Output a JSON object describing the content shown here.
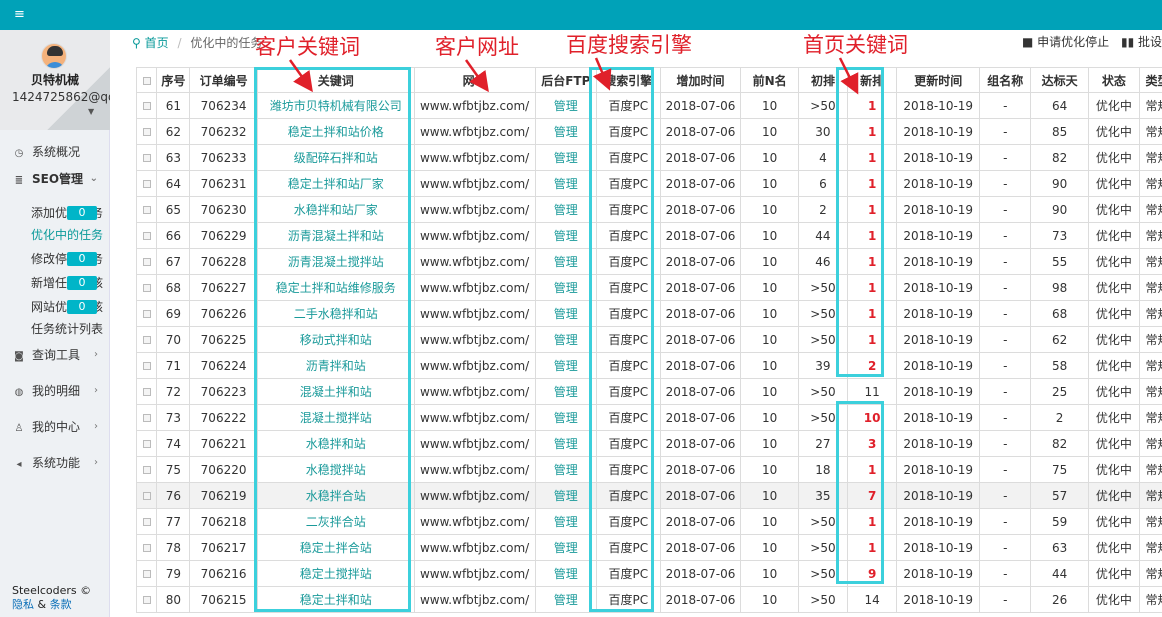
{
  "topbar": {
    "menu_icon": "≡"
  },
  "sidebar": {
    "user_name": "贝特机械",
    "user_id": "1424725862@qq.",
    "nav": [
      {
        "icon": "◷",
        "label": "系统概况"
      },
      {
        "icon": "≣",
        "label": "SEO管理",
        "arrow": "⌄"
      },
      {
        "icon": "◙",
        "label": "查询工具",
        "arrow": "›"
      },
      {
        "icon": "◍",
        "label": "我的明细",
        "arrow": "›"
      },
      {
        "icon": "♙",
        "label": "我的中心",
        "arrow": "›"
      },
      {
        "icon": "◂",
        "label": "系统功能",
        "arrow": "›"
      }
    ],
    "sub": [
      {
        "label": "添加优化任务",
        "badge": "0"
      },
      {
        "label": "优化中的任务"
      },
      {
        "label": "修改停止任务",
        "badge": "0"
      },
      {
        "label": "新增任务审核",
        "badge": "0"
      },
      {
        "label": "网站优化审核",
        "badge": "0"
      },
      {
        "label": "任务统计列表"
      }
    ],
    "footer": {
      "text": "Steelcoders ©",
      "privacy": "隐私",
      "amp": "&",
      "terms": "条款"
    }
  },
  "breadcrumb": {
    "home": "首页",
    "sep": "/",
    "current": "优化中的任务"
  },
  "actions": {
    "stop": "■ 申请优化停止",
    "batch": "▮▮ 批设"
  },
  "table": {
    "headers": [
      "",
      "序号",
      "订单编号",
      "关键词",
      "网址",
      "后台FTP",
      "搜索引擎",
      "增加时间",
      "前N名",
      "初排",
      "新排",
      "更新时间",
      "组名称",
      "达标天",
      "状态",
      "类型"
    ],
    "rows": [
      [
        "61",
        "706234",
        "潍坊市贝特机械有限公司",
        "www.wfbtjbz.com/",
        "管理",
        "百度PC",
        "2018-07-06",
        "10",
        ">50",
        "1",
        "2018-10-19",
        "-",
        "64",
        "优化中",
        "常规"
      ],
      [
        "62",
        "706232",
        "稳定土拌和站价格",
        "www.wfbtjbz.com/",
        "管理",
        "百度PC",
        "2018-07-06",
        "10",
        "30",
        "1",
        "2018-10-19",
        "-",
        "85",
        "优化中",
        "常规"
      ],
      [
        "63",
        "706233",
        "级配碎石拌和站",
        "www.wfbtjbz.com/",
        "管理",
        "百度PC",
        "2018-07-06",
        "10",
        "4",
        "1",
        "2018-10-19",
        "-",
        "82",
        "优化中",
        "常规"
      ],
      [
        "64",
        "706231",
        "稳定土拌和站厂家",
        "www.wfbtjbz.com/",
        "管理",
        "百度PC",
        "2018-07-06",
        "10",
        "6",
        "1",
        "2018-10-19",
        "-",
        "90",
        "优化中",
        "常规"
      ],
      [
        "65",
        "706230",
        "水稳拌和站厂家",
        "www.wfbtjbz.com/",
        "管理",
        "百度PC",
        "2018-07-06",
        "10",
        "2",
        "1",
        "2018-10-19",
        "-",
        "90",
        "优化中",
        "常规"
      ],
      [
        "66",
        "706229",
        "沥青混凝土拌和站",
        "www.wfbtjbz.com/",
        "管理",
        "百度PC",
        "2018-07-06",
        "10",
        "44",
        "1",
        "2018-10-19",
        "-",
        "73",
        "优化中",
        "常规"
      ],
      [
        "67",
        "706228",
        "沥青混凝土搅拌站",
        "www.wfbtjbz.com/",
        "管理",
        "百度PC",
        "2018-07-06",
        "10",
        "46",
        "1",
        "2018-10-19",
        "-",
        "55",
        "优化中",
        "常规"
      ],
      [
        "68",
        "706227",
        "稳定土拌和站维修服务",
        "www.wfbtjbz.com/",
        "管理",
        "百度PC",
        "2018-07-06",
        "10",
        ">50",
        "1",
        "2018-10-19",
        "-",
        "98",
        "优化中",
        "常规"
      ],
      [
        "69",
        "706226",
        "二手水稳拌和站",
        "www.wfbtjbz.com/",
        "管理",
        "百度PC",
        "2018-07-06",
        "10",
        ">50",
        "1",
        "2018-10-19",
        "-",
        "68",
        "优化中",
        "常规"
      ],
      [
        "70",
        "706225",
        "移动式拌和站",
        "www.wfbtjbz.com/",
        "管理",
        "百度PC",
        "2018-07-06",
        "10",
        ">50",
        "1",
        "2018-10-19",
        "-",
        "62",
        "优化中",
        "常规"
      ],
      [
        "71",
        "706224",
        "沥青拌和站",
        "www.wfbtjbz.com/",
        "管理",
        "百度PC",
        "2018-07-06",
        "10",
        "39",
        "2",
        "2018-10-19",
        "-",
        "58",
        "优化中",
        "常规"
      ],
      [
        "72",
        "706223",
        "混凝土拌和站",
        "www.wfbtjbz.com/",
        "管理",
        "百度PC",
        "2018-07-06",
        "10",
        ">50",
        "11",
        "2018-10-19",
        "-",
        "25",
        "优化中",
        "常规"
      ],
      [
        "73",
        "706222",
        "混凝土搅拌站",
        "www.wfbtjbz.com/",
        "管理",
        "百度PC",
        "2018-07-06",
        "10",
        ">50",
        "10",
        "2018-10-19",
        "-",
        "2",
        "优化中",
        "常规"
      ],
      [
        "74",
        "706221",
        "水稳拌和站",
        "www.wfbtjbz.com/",
        "管理",
        "百度PC",
        "2018-07-06",
        "10",
        "27",
        "3",
        "2018-10-19",
        "-",
        "82",
        "优化中",
        "常规"
      ],
      [
        "75",
        "706220",
        "水稳搅拌站",
        "www.wfbtjbz.com/",
        "管理",
        "百度PC",
        "2018-07-06",
        "10",
        "18",
        "1",
        "2018-10-19",
        "-",
        "75",
        "优化中",
        "常规"
      ],
      [
        "76",
        "706219",
        "水稳拌合站",
        "www.wfbtjbz.com/",
        "管理",
        "百度PC",
        "2018-07-06",
        "10",
        "35",
        "7",
        "2018-10-19",
        "-",
        "57",
        "优化中",
        "常规"
      ],
      [
        "77",
        "706218",
        "二灰拌合站",
        "www.wfbtjbz.com/",
        "管理",
        "百度PC",
        "2018-07-06",
        "10",
        ">50",
        "1",
        "2018-10-19",
        "-",
        "59",
        "优化中",
        "常规"
      ],
      [
        "78",
        "706217",
        "稳定土拌合站",
        "www.wfbtjbz.com/",
        "管理",
        "百度PC",
        "2018-07-06",
        "10",
        ">50",
        "1",
        "2018-10-19",
        "-",
        "63",
        "优化中",
        "常规"
      ],
      [
        "79",
        "706216",
        "稳定土搅拌站",
        "www.wfbtjbz.com/",
        "管理",
        "百度PC",
        "2018-07-06",
        "10",
        ">50",
        "9",
        "2018-10-19",
        "-",
        "44",
        "优化中",
        "常规"
      ],
      [
        "80",
        "706215",
        "稳定土拌和站",
        "www.wfbtjbz.com/",
        "管理",
        "百度PC",
        "2018-07-06",
        "10",
        ">50",
        "14",
        "2018-10-19",
        "-",
        "26",
        "优化中",
        "常规"
      ]
    ],
    "highlight_row": "76",
    "red_rows": [
      "61",
      "62",
      "63",
      "64",
      "65",
      "66",
      "67",
      "68",
      "69",
      "70",
      "71",
      "73",
      "74",
      "75",
      "76",
      "77",
      "78",
      "79"
    ]
  },
  "annotations": {
    "keyword": "客户关键词",
    "url": "客户网址",
    "engine": "百度搜索引擎",
    "homepage": "首页关键词"
  },
  "colors": {
    "topbar": "#00a2b8",
    "accent": "#1a9a9a",
    "annotation": "#e0202a",
    "box": "#3cd0dc"
  }
}
